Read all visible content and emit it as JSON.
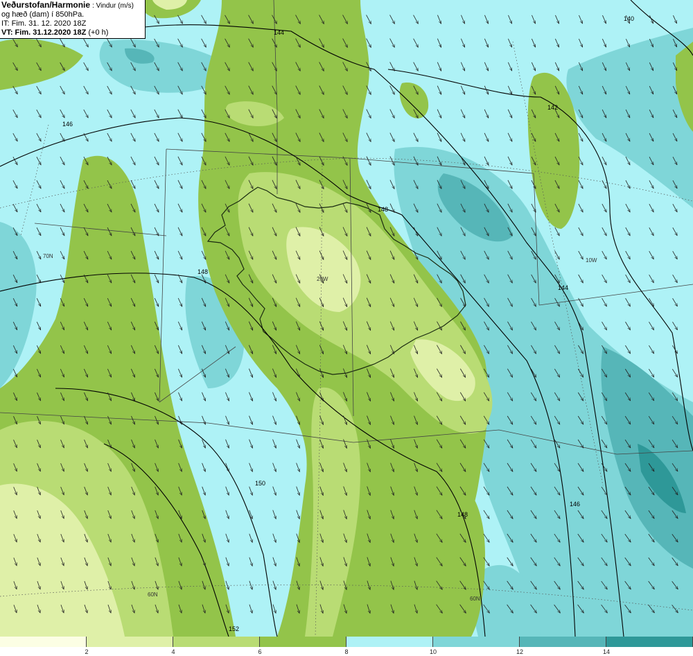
{
  "header": {
    "source": "Veðurstofan/Harmonie",
    "variable": "Vindur (m/s)",
    "line2": "og hæð (dam) í 850hPa.",
    "init_time": "IT: Fim. 31. 12. 2020 18Z",
    "valid_time": "VT: Fim. 31.12.2020 18Z",
    "lead": "(+0 h)"
  },
  "contour_labels": [
    "140",
    "142",
    "144",
    "146",
    "148",
    "150",
    "152"
  ],
  "grid_labels": [
    "70N",
    "20W",
    "10W",
    "60N"
  ],
  "legend": {
    "ticks": [
      "2",
      "4",
      "6",
      "8",
      "10",
      "12",
      "14"
    ],
    "colors": [
      "#fcfee4",
      "#dff0a8",
      "#b9dc74",
      "#93c44a",
      "#aef2f6",
      "#7fd6d8",
      "#56b6b8",
      "#2e9898"
    ]
  },
  "wind_direction": "north-to-south"
}
